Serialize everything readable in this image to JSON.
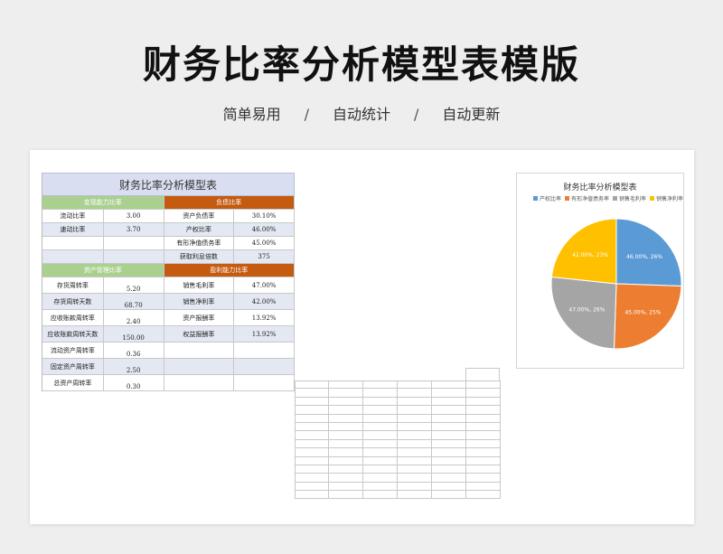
{
  "page": {
    "title": "财务比率分析模型表模版",
    "tags": [
      "简单易用",
      "自动统计",
      "自动更新"
    ],
    "separator": "/"
  },
  "table": {
    "title": "财务比率分析模型表",
    "sections": {
      "liquidity": "变现能力比率",
      "debt": "负债比率",
      "asset_mgmt": "资产管理比率",
      "profit": "盈利能力比率"
    },
    "rows1": [
      {
        "l1": "流动比率",
        "v1": "3.00",
        "l2": "资产负债率",
        "v2": "30.10%"
      },
      {
        "l1": "速动比率",
        "v1": "3.70",
        "l2": "产权比率",
        "v2": "46.00%"
      },
      {
        "l1": "",
        "v1": "",
        "l2": "有形净值债务率",
        "v2": "45.00%"
      },
      {
        "l1": "",
        "v1": "",
        "l2": "获取利息倍数",
        "v2": "375"
      }
    ],
    "rows2": [
      {
        "l1": "存货周转率",
        "v1": "5.20",
        "l2": "销售毛利率",
        "v2": "47.00%"
      },
      {
        "l1": "存货周转天数",
        "v1": "68.70",
        "l2": "销售净利率",
        "v2": "42.00%"
      },
      {
        "l1": "应收账款周转率",
        "v1": "2.40",
        "l2": "资产报酬率",
        "v2": "13.92%"
      },
      {
        "l1": "应收账款周转天数",
        "v1": "150.00",
        "l2": "权益报酬率",
        "v2": "13.92%"
      },
      {
        "l1": "流动资产周转率",
        "v1": "0.36",
        "l2": "",
        "v2": ""
      },
      {
        "l1": "固定资产周转率",
        "v1": "2.50",
        "l2": "",
        "v2": ""
      },
      {
        "l1": "总资产周转率",
        "v1": "0.30",
        "l2": "",
        "v2": ""
      }
    ]
  },
  "chart_data": {
    "type": "pie",
    "title": "财务比率分析模型表",
    "labels": [
      "产权比率",
      "有形净值债务率",
      "销售毛利率",
      "销售净利率"
    ],
    "values": [
      46,
      45,
      47,
      42
    ],
    "data_labels": [
      "46.00%, 26%",
      "45.00%, 25%",
      "47.00%, 26%",
      "42.00%, 23%"
    ],
    "colors": [
      "#5b9bd5",
      "#ed7d31",
      "#a5a5a5",
      "#ffc000"
    ],
    "legend": "top"
  }
}
